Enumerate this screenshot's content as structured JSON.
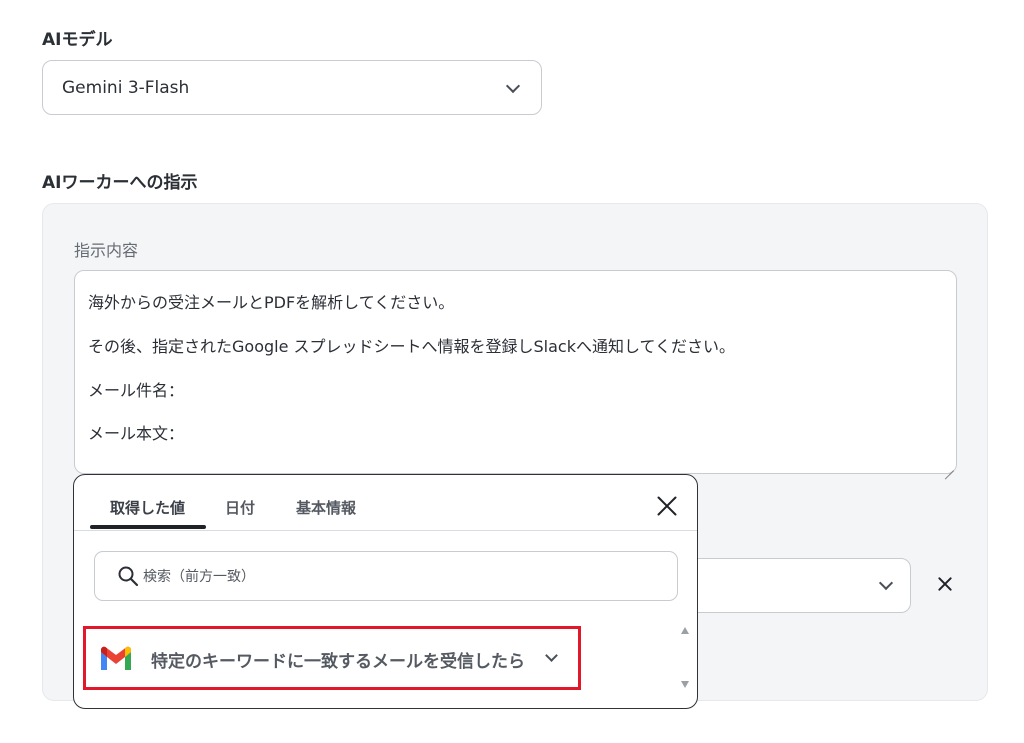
{
  "ai_model": {
    "label": "AIモデル",
    "selected": "Gemini 3-Flash",
    "icon": "chevron-down-icon"
  },
  "instructions": {
    "label": "AIワーカーへの指示",
    "content_label": "指示内容",
    "lines": [
      "海外からの受注メールとPDFを解析してください。",
      "その後、指定されたGoogle スプレッドシートへ情報を登録しSlackへ通知してください。",
      "メール件名：",
      "メール本文："
    ]
  },
  "popup": {
    "tabs": [
      {
        "label": "取得した値",
        "active": true
      },
      {
        "label": "日付",
        "active": false
      },
      {
        "label": "基本情報",
        "active": false
      }
    ],
    "search_placeholder": "検索（前方一致）",
    "items": [
      {
        "label": "特定のキーワードに一致するメールを受信したら",
        "icon": "gmail-icon",
        "highlight_color": "#e0182a"
      }
    ]
  },
  "colors": {
    "text": "#2b2f36",
    "muted": "#666b73",
    "panel_bg": "#f4f5f7",
    "border": "#c8cbd0",
    "highlight": "#e0182a"
  }
}
